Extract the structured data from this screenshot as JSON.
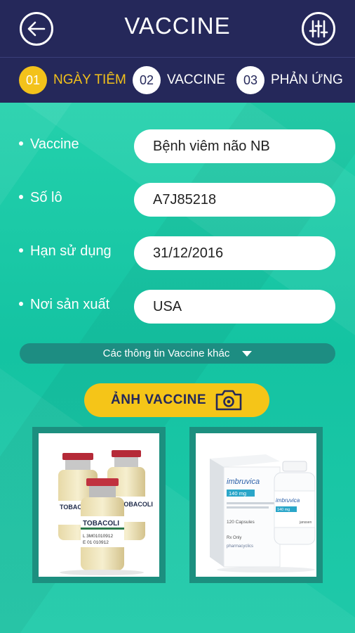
{
  "header": {
    "title": "VACCINE",
    "back_icon": "arrow-left-icon",
    "filter_icon": "sliders-icon"
  },
  "steps": [
    {
      "num": "01",
      "label": "NGÀY TIÊM",
      "active": true
    },
    {
      "num": "02",
      "label": "VACCINE",
      "active": false
    },
    {
      "num": "03",
      "label": "PHẢN ỨNG",
      "active": false
    }
  ],
  "form": {
    "vaccine": {
      "label": "Vaccine",
      "value": "Bệnh viêm não NB"
    },
    "lot": {
      "label": "Số lô",
      "value": "A7J85218"
    },
    "expiry": {
      "label": "Hạn sử dụng",
      "value": "31/12/2016"
    },
    "origin": {
      "label": "Nơi sản xuất",
      "value": "USA"
    }
  },
  "more_info": "Các thông tin Vaccine khác",
  "photo_button": "ẢNH VACCINE",
  "photos": {
    "photo1": {
      "brand": "TOBACOLI",
      "lot_text": "L 3M01010912",
      "lot_text2": "E 01 010912"
    },
    "photo2": {
      "brand": "imbruvica",
      "strength": "140 mg",
      "caption": "120 Capsules",
      "rx": "Rx Only",
      "maker": "pharmacyclics",
      "maker2": "janssen"
    }
  },
  "colors": {
    "header_bg": "#25285a",
    "accent": "#f3c21b",
    "teal": "#1ec8a4"
  }
}
